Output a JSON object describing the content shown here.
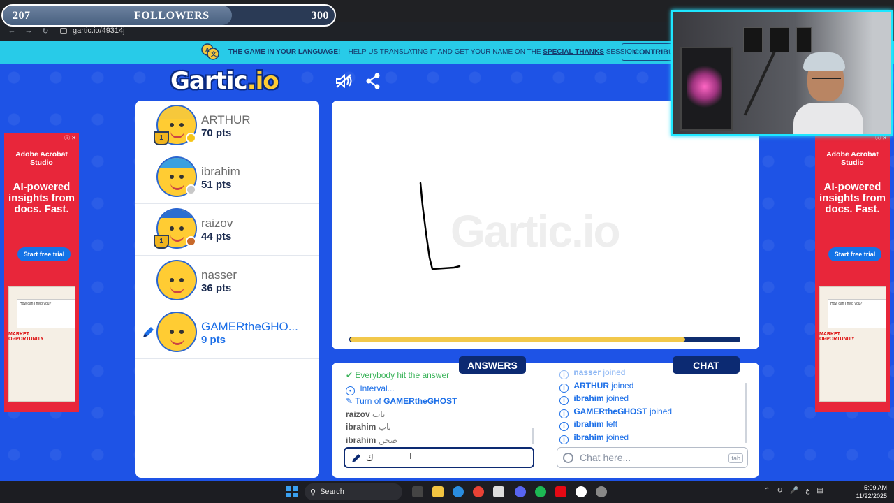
{
  "overlay": {
    "followers_current": "207",
    "followers_label": "FOLLOWERS",
    "followers_goal": "300",
    "followers_progress": 0.69
  },
  "browser": {
    "url": "gartic.io/49314j"
  },
  "banner": {
    "headline": "THE GAME IN YOUR LANGUAGE!",
    "text_before_link": "HELP US TRANSLATING IT AND GET YOUR NAME ON THE",
    "link": "SPECIAL THANKS",
    "text_after_link": "SESSION",
    "button": "CONTRIBUTE"
  },
  "header": {
    "logo_main": "Gartic",
    "logo_io": ".io",
    "icons": [
      "mute-icon",
      "share-icon"
    ]
  },
  "players": [
    {
      "name": "ARTHUR",
      "points": "70 pts",
      "rank": "1",
      "badge_color": "#f5c518",
      "avatar": "cap-icon"
    },
    {
      "name": "ibrahim",
      "points": "51 pts",
      "badge_color": "#c8c8c8",
      "avatar": "turban-icon"
    },
    {
      "name": "raizov",
      "points": "44 pts",
      "rank": "1",
      "badge_color": "#c8692b",
      "avatar": "hair-icon"
    },
    {
      "name": "nasser",
      "points": "36 pts",
      "avatar": "plain-icon"
    },
    {
      "name": "GAMERtheGHO...",
      "points": "9 pts",
      "drawing": true,
      "avatar": "plain-icon"
    }
  ],
  "canvas": {
    "watermark": "Gartic.io",
    "timer_progress": 0.86
  },
  "tabs": {
    "answers": "ANSWERS",
    "chat": "CHAT"
  },
  "answers_feed": [
    {
      "text": "Everybody hit the answer",
      "style": "green"
    },
    {
      "text": "Interval...",
      "style": "blue",
      "icon": "clock-icon"
    },
    {
      "text": "Turn of ",
      "bold": "GAMERtheGHOST",
      "style": "blue",
      "icon": "pencil-icon"
    },
    {
      "user": "raizov",
      "guess": "باب"
    },
    {
      "user": "ibrahim",
      "guess": "باب"
    },
    {
      "user": "ibrahim",
      "guess": "صحن"
    }
  ],
  "chat_feed": [
    {
      "user": "nasser",
      "action": "joined"
    },
    {
      "user": "ARTHUR",
      "action": "joined"
    },
    {
      "user": "ibrahim",
      "action": "joined"
    },
    {
      "user": "GAMERtheGHOST",
      "action": "joined"
    },
    {
      "user": "ibrahim",
      "action": "left"
    },
    {
      "user": "ibrahim",
      "action": "joined"
    }
  ],
  "answer_input": {
    "value": "ك"
  },
  "chat_input": {
    "placeholder": "Chat here...",
    "key_hint": "tab"
  },
  "ads": {
    "brand": "Adobe Acrobat Studio",
    "headline": "AI-powered insights from docs. Fast.",
    "cta": "Start free trial",
    "card_text": "How can I help you?",
    "badge_text": "MARKET OPPORTUNITY"
  },
  "taskbar": {
    "search": "Search",
    "time": "5:09 AM",
    "date": "11/22/2025",
    "lang": "ع"
  }
}
